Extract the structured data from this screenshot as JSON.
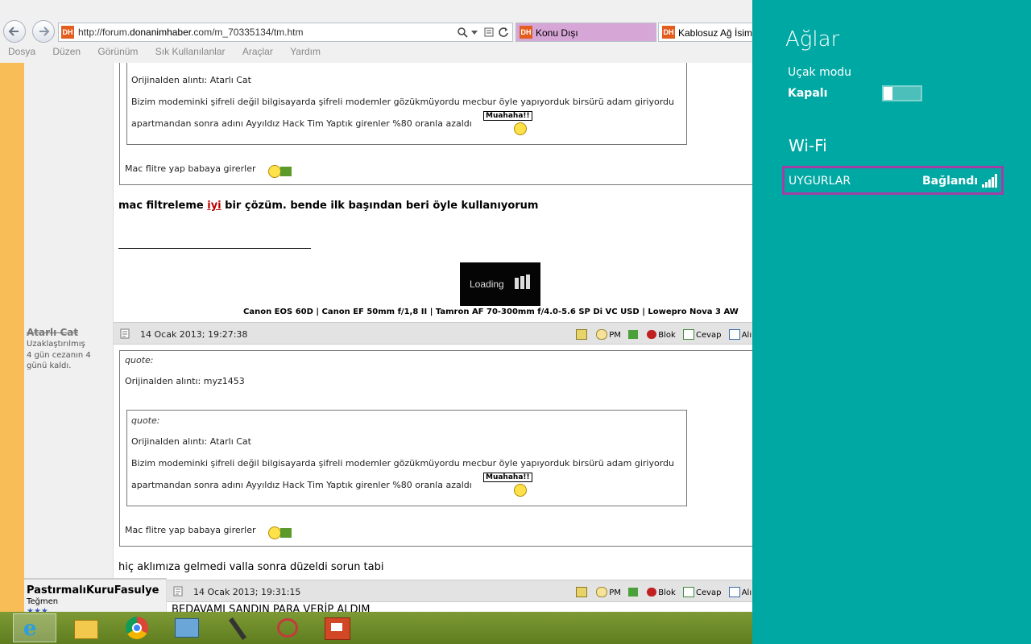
{
  "browser": {
    "address": {
      "prefix": "http://forum.",
      "host": "donanimhaber",
      "suffix": ".com/m_70335134/tm.htm"
    },
    "tabs": [
      {
        "label": "Konu Dışı",
        "color": "#d6a6d6"
      },
      {
        "label": "Kablosuz Ağ İsiml",
        "color": "#ffffff"
      }
    ],
    "menu": [
      "Dosya",
      "Düzen",
      "Görünüm",
      "Sık Kullanılanlar",
      "Araçlar",
      "Yardım"
    ],
    "dh_logo": "DH"
  },
  "post1": {
    "inner_quote_label": "Orijinalden alıntı: Atarlı Cat",
    "inner_quote_line1": "Bizim modeminki şifreli değil bilgisayarda şifreli modemler gözükmüyordu mecbur öyle yapıyorduk birsürü adam giriyordu",
    "inner_quote_line2": "apartmandan sonra adını Ayyıldız Hack Tim Yaptık girenler %80 oranla azaldı",
    "sign_text": "Muahaha!!",
    "outer_line": "Mac flitre yap babaya girerler",
    "reply_before": "mac filtreleme ",
    "reply_link": "iyi",
    "reply_after": " bir çözüm. bende ilk başından beri öyle kullanıyorum",
    "loading_text": "Loading",
    "signature": "Canon EOS 60D | Canon EF 50mm f/1,8 II | Tamron AF 70-300mm f/4.0-5.6 SP Di VC USD | Lowepro Nova 3 AW"
  },
  "post2": {
    "user": "Atarlı Cat",
    "user_status": "Uzaklaştırılmış",
    "user_note": "4 gün cezanın 4 günü kaldı.",
    "date": "14 Ocak 2013; 19:27:38",
    "quote_label": "quote:",
    "outer_quote_label": "Orijinalden alıntı: myz1453",
    "inner_quote_label": "Orijinalden alıntı: Atarlı Cat",
    "inner_quote_line1": "Bizim modeminki şifreli değil bilgisayarda şifreli modemler gözükmüyordu mecbur öyle yapıyorduk birsürü adam giriyordu",
    "inner_quote_line2": "apartmandan sonra adını Ayyıldız Hack Tim Yaptık girenler %80 oranla azaldı",
    "sign_text": "Muahaha!!",
    "outer_line": "Mac flitre yap babaya girerler",
    "reply": "hiç aklımıza gelmedi valla sonra düzeldi sorun tabi"
  },
  "post3": {
    "user": "PastırmalıKuruFasulye",
    "rank": "Teğmen",
    "date": "14 Ocak 2013; 19:31:15",
    "text": "BEDAVAMI SANDIN PARA VERİP ALDIM"
  },
  "actions": {
    "pm": "PM",
    "block": "Blok",
    "reply": "Cevap",
    "quote": "Alıntı"
  },
  "charm": {
    "title": "Ağlar",
    "airplane_label": "Uçak modu",
    "airplane_state": "Kapalı",
    "wifi_header": "Wi-Fi",
    "network_name": "UYGURLAR",
    "network_status": "Bağlandı",
    "bg_color": "#00a8a3",
    "highlight_color": "#a23fa6"
  },
  "taskbar": {
    "apps": [
      "internet-explorer-icon",
      "file-explorer-icon",
      "chrome-icon",
      "control-panel-icon",
      "microphone-icon",
      "snipping-tool-icon",
      "powerpoint-icon"
    ]
  }
}
